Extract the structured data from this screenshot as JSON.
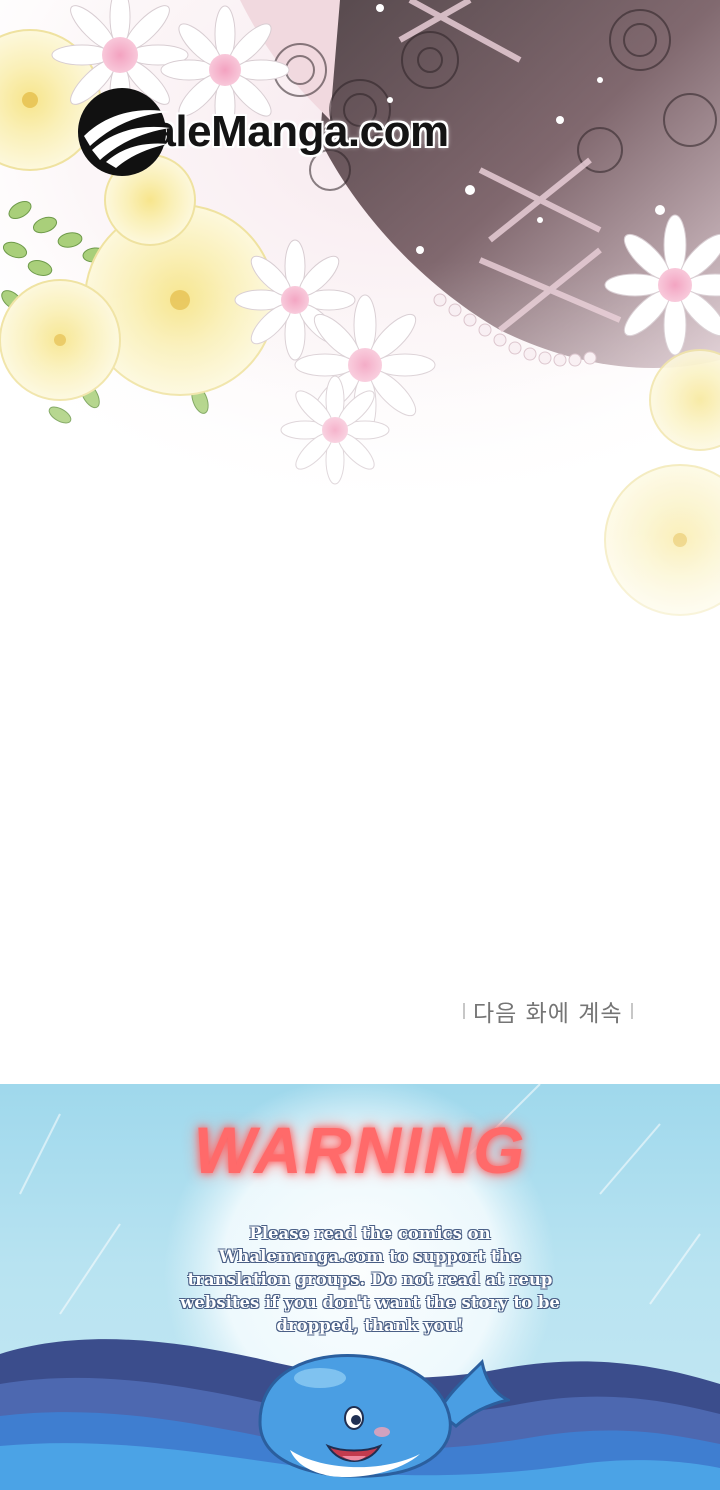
{
  "watermark": {
    "site": "WhaleManga.com",
    "logo_icon": "whale-swoosh-logo"
  },
  "caption": {
    "text": "다음 화에 계속"
  },
  "warning_banner": {
    "title": "WARNING",
    "message": "Please read the comics on Whalemanga.com to support the translation groups. Do not read at reup websites if you don't want the story to be dropped, thank you!",
    "mascot_icon": "whale-mascot-icon"
  },
  "colors": {
    "banner_sky": "#b8e3f1",
    "warning_red": "#ff6a6a",
    "sea_dark": "#3b4d8c",
    "whale_blue": "#4a9ee3"
  }
}
